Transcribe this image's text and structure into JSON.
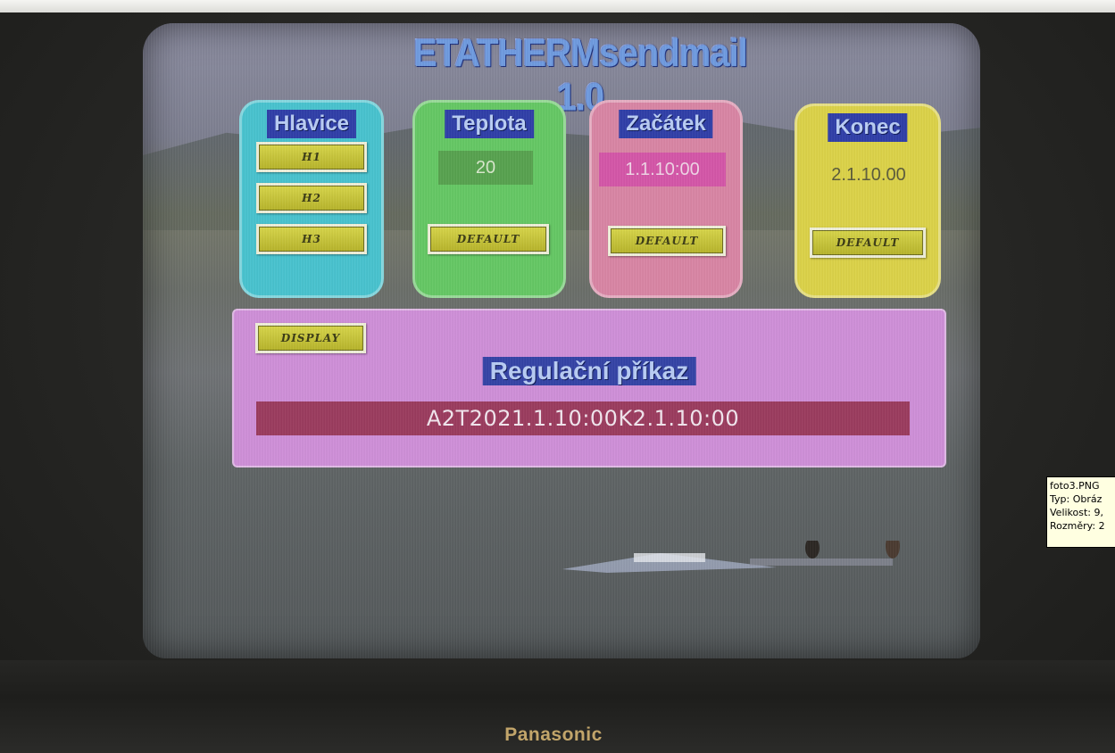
{
  "tv": {
    "brand": "Panasonic"
  },
  "app": {
    "title": "ETATHERMsendmail 1.0"
  },
  "panels": {
    "hlavice": {
      "header": "Hlavice",
      "buttons": [
        "H1",
        "H2",
        "H3"
      ]
    },
    "teplota": {
      "header": "Teplota",
      "value": "20",
      "default_label": "DEFAULT"
    },
    "zacatek": {
      "header": "Začátek",
      "value": "1.1.10:00",
      "default_label": "DEFAULT"
    },
    "konec": {
      "header": "Konec",
      "value": "2.1.10.00",
      "default_label": "DEFAULT"
    },
    "regulace": {
      "display_button": "DISPLAY",
      "title": "Regulační příkaz",
      "command": "A2T2021.1.10:00K2.1.10:00"
    }
  },
  "tooltip": {
    "lines": [
      "foto3.PNG",
      "Typ: Obráz",
      "Velikost: 9,",
      "Rozměry: 2"
    ]
  },
  "colors": {
    "hlavice": "#48c3cf",
    "teplota": "#65c864",
    "zacatek": "#d985a4",
    "konec": "#dcd248",
    "regulace": "#cf8fd8",
    "header_bg": "#2f3ea8",
    "command_bar": "#9b3b5e"
  }
}
